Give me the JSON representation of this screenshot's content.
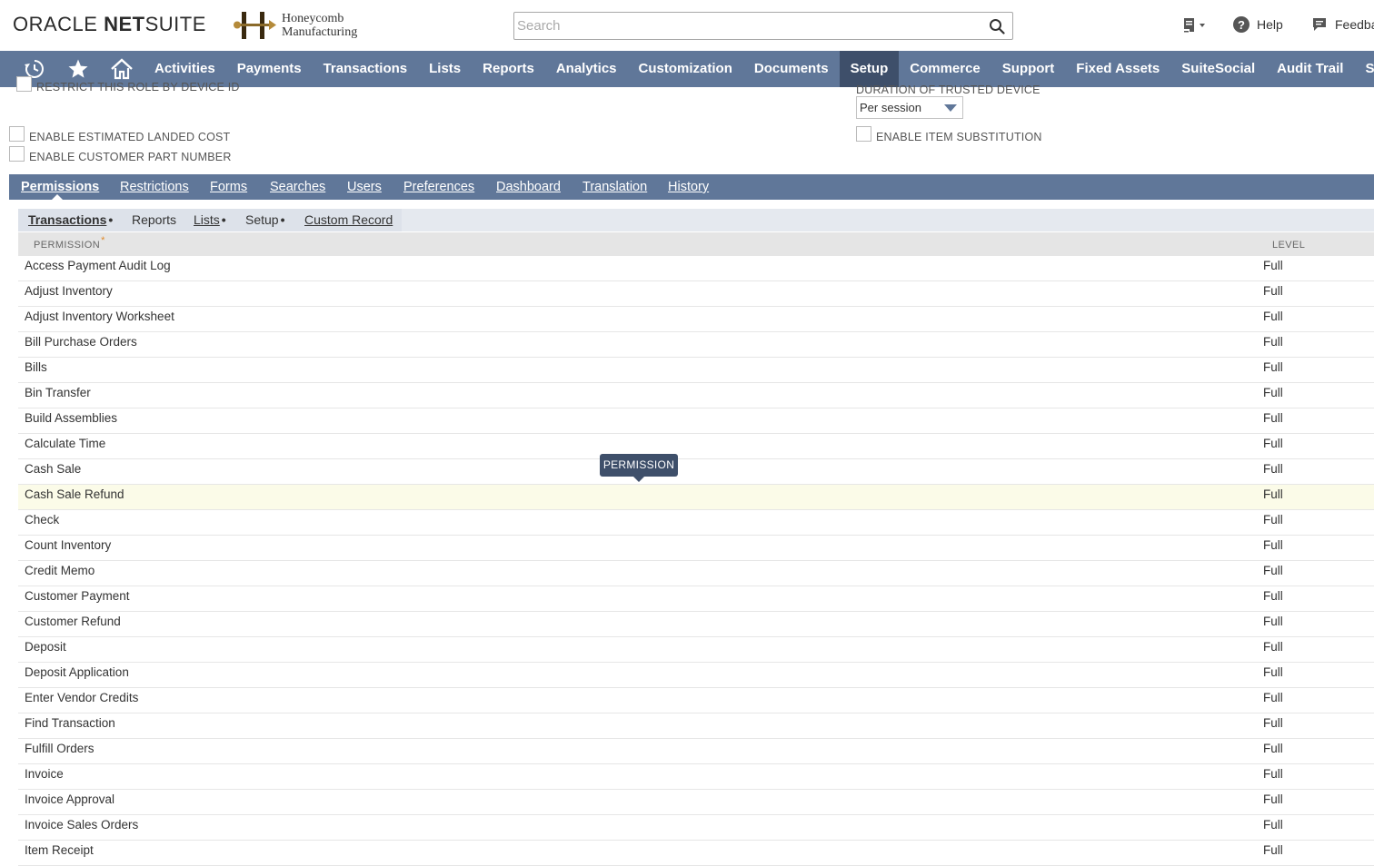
{
  "header": {
    "logo_word1": "ORACLE",
    "logo_word2": "NET",
    "logo_word3": "SUITE",
    "company_line1": "Honeycomb",
    "company_line2": "Manufacturing",
    "search_placeholder": "Search",
    "help_label": "Help",
    "feedback_label": "Feedback",
    "icons": [
      "search-icon",
      "recent-records-icon",
      "help-icon",
      "feedback-icon"
    ]
  },
  "nav": {
    "icons": [
      "recent-history-icon",
      "favorites-star-icon",
      "home-icon"
    ],
    "items": [
      {
        "label": "Activities"
      },
      {
        "label": "Payments"
      },
      {
        "label": "Transactions"
      },
      {
        "label": "Lists"
      },
      {
        "label": "Reports"
      },
      {
        "label": "Analytics"
      },
      {
        "label": "Customization"
      },
      {
        "label": "Documents"
      },
      {
        "label": "Setup",
        "active": true
      },
      {
        "label": "Commerce"
      },
      {
        "label": "Support"
      },
      {
        "label": "Fixed Assets"
      },
      {
        "label": "SuiteSocial"
      },
      {
        "label": "Audit Trail"
      },
      {
        "label": "SuiteA"
      }
    ],
    "color": "#607799",
    "active_color": "#3e4f6a"
  },
  "form": {
    "restrict_device_label": "RESTRICT THIS ROLE BY DEVICE ID",
    "duration_label": "DURATION OF TRUSTED DEVICE",
    "duration_value": "Per session",
    "landed_cost_label": "ENABLE ESTIMATED LANDED COST",
    "customer_part_label": "ENABLE CUSTOMER PART NUMBER",
    "item_substitution_label": "ENABLE ITEM SUBSTITUTION"
  },
  "subtabs": [
    {
      "label": "Permissions",
      "active": true
    },
    {
      "label": "Restrictions"
    },
    {
      "label": "Forms"
    },
    {
      "label": "Searches"
    },
    {
      "label": "Users"
    },
    {
      "label": "Preferences"
    },
    {
      "label": "Dashboard"
    },
    {
      "label": "Translation"
    },
    {
      "label": "History"
    }
  ],
  "inner_tabs": [
    {
      "label": "Transactions",
      "dot": "•",
      "active": true
    },
    {
      "label": "Reports",
      "dot": ""
    },
    {
      "label": "Lists",
      "dot": "•"
    },
    {
      "label": "Setup",
      "dot": "•"
    },
    {
      "label": "Custom Record",
      "dot": ""
    }
  ],
  "table": {
    "col_permission": "PERMISSION",
    "required_mark": "*",
    "col_level": "LEVEL",
    "rows": [
      {
        "permission": "Access Payment Audit Log",
        "level": "Full"
      },
      {
        "permission": "Adjust Inventory",
        "level": "Full"
      },
      {
        "permission": "Adjust Inventory Worksheet",
        "level": "Full"
      },
      {
        "permission": "Bill Purchase Orders",
        "level": "Full"
      },
      {
        "permission": "Bills",
        "level": "Full"
      },
      {
        "permission": "Bin Transfer",
        "level": "Full"
      },
      {
        "permission": "Build Assemblies",
        "level": "Full"
      },
      {
        "permission": "Calculate Time",
        "level": "Full"
      },
      {
        "permission": "Cash Sale",
        "level": "Full"
      },
      {
        "permission": "Cash Sale Refund",
        "level": "Full",
        "highlighted": true
      },
      {
        "permission": "Check",
        "level": "Full"
      },
      {
        "permission": "Count Inventory",
        "level": "Full"
      },
      {
        "permission": "Credit Memo",
        "level": "Full"
      },
      {
        "permission": "Customer Payment",
        "level": "Full"
      },
      {
        "permission": "Customer Refund",
        "level": "Full"
      },
      {
        "permission": "Deposit",
        "level": "Full"
      },
      {
        "permission": "Deposit Application",
        "level": "Full"
      },
      {
        "permission": "Enter Vendor Credits",
        "level": "Full"
      },
      {
        "permission": "Find Transaction",
        "level": "Full"
      },
      {
        "permission": "Fulfill Orders",
        "level": "Full"
      },
      {
        "permission": "Invoice",
        "level": "Full"
      },
      {
        "permission": "Invoice Approval",
        "level": "Full"
      },
      {
        "permission": "Invoice Sales Orders",
        "level": "Full"
      },
      {
        "permission": "Item Receipt",
        "level": "Full"
      }
    ]
  },
  "tooltip": {
    "text": "PERMISSION"
  }
}
